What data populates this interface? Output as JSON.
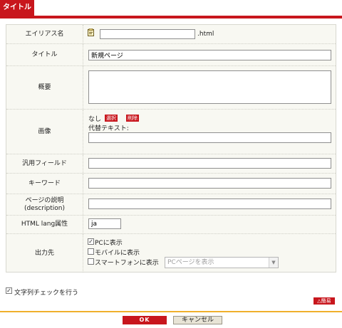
{
  "tab": {
    "title": "タイトル"
  },
  "form": {
    "alias": {
      "label": "エイリアス名",
      "value": "",
      "suffix": ".html"
    },
    "title": {
      "label": "タイトル",
      "value": "新規ページ"
    },
    "summary": {
      "label": "概要",
      "value": ""
    },
    "image": {
      "label": "画像",
      "status": "なし",
      "select_label": "選択",
      "delete_label": "削除",
      "alt_label": "代替テキスト:",
      "alt_value": ""
    },
    "general_field": {
      "label": "汎用フィールド",
      "value": ""
    },
    "keyword": {
      "label": "キーワード",
      "value": ""
    },
    "description": {
      "label_line1": "ページの説明",
      "label_line2": "(description)",
      "value": ""
    },
    "lang": {
      "label": "HTML lang属性",
      "value": "ja"
    },
    "output": {
      "label": "出力先",
      "pc": {
        "label": "PCに表示",
        "checked": true
      },
      "mobile": {
        "label": "モバイルに表示",
        "checked": false
      },
      "smartphone": {
        "label": "スマートフォンに表示",
        "checked": false
      },
      "smartphone_select": "PCページを表示"
    }
  },
  "check_string": {
    "label": "文字列チェックを行う",
    "checked": true
  },
  "buttons": {
    "simple": "△簡易",
    "ok": "OK",
    "cancel": "キャンセル"
  },
  "colors": {
    "accent": "#c8161d",
    "footer_line": "#f0b02c",
    "panel_bg": "#f8f8f2"
  }
}
